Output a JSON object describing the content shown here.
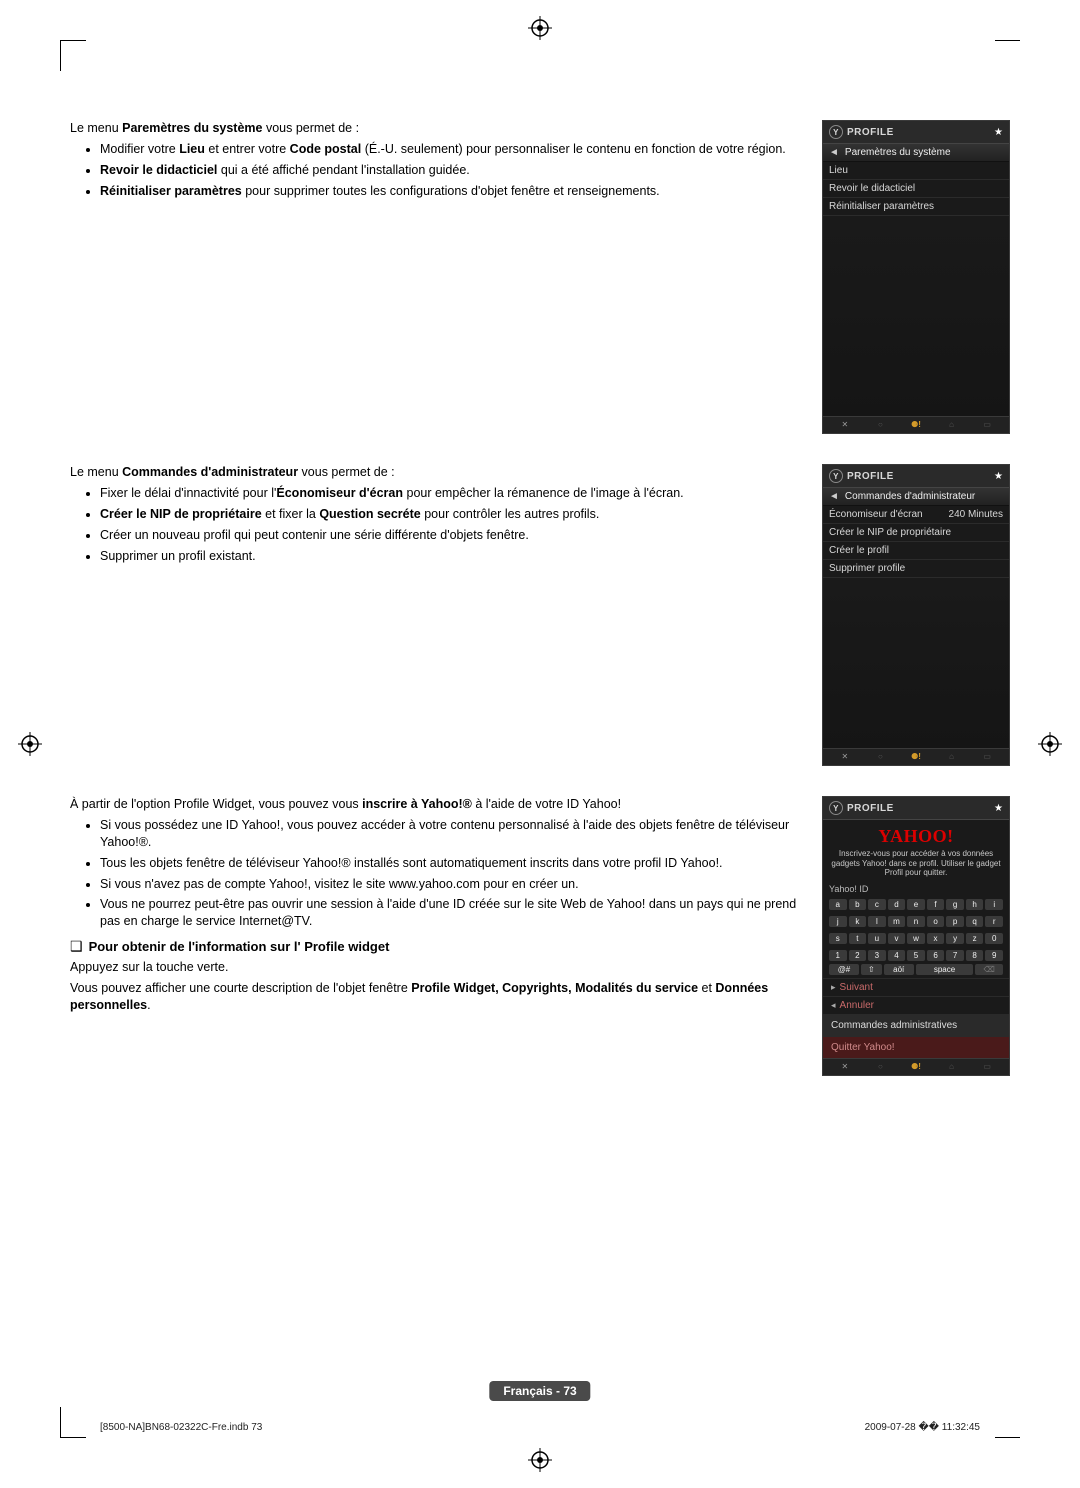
{
  "sec1": {
    "intro_pre": "Le menu ",
    "intro_bold": "Paremètres du système",
    "intro_post": " vous permet de :",
    "b1_pre": "Modifier votre ",
    "b1_b1": "Lieu",
    "b1_mid": " et entrer votre ",
    "b1_b2": "Code postal",
    "b1_post": " (É.-U. seulement) pour personnaliser le contenu en fonction de votre région.",
    "b2_b": "Revoir le didacticiel",
    "b2_post": " qui a été affiché pendant l'installation guidée.",
    "b3_b": "Réinitialiser paramètres",
    "b3_post": " pour supprimer toutes les configurations d'objet fenêtre et renseignements."
  },
  "widget1": {
    "title": "PROFILE",
    "sub": "Paremètres du système",
    "r1": "Lieu",
    "r2": "Revoir le didacticiel",
    "r3": "Réinitialiser paramètres"
  },
  "sec2": {
    "intro_pre": "Le menu ",
    "intro_bold": "Commandes d'administrateur",
    "intro_post": " vous permet de :",
    "b1_pre": "Fixer le délai d'innactivité pour l'",
    "b1_b": "Économiseur d'écran",
    "b1_post": " pour empêcher la rémanence de l'image à l'écran.",
    "b2_b1": "Créer le NIP de propriétaire",
    "b2_mid": " et fixer la ",
    "b2_b2": "Question secréte",
    "b2_post": " pour contrôler les autres profils.",
    "b3": "Créer un nouveau profil qui peut contenir une série différente d'objets fenêtre.",
    "b4": "Supprimer un profil existant."
  },
  "widget2": {
    "title": "PROFILE",
    "sub": "Commandes d'administrateur",
    "r1a": "Économiseur d'écran",
    "r1b": "240 Minutes",
    "r2": "Créer le NIP de propriétaire",
    "r3": "Créer le profil",
    "r4": "Supprimer profile"
  },
  "sec3": {
    "p1_pre": "À partir de l'option Profile Widget, vous pouvez vous ",
    "p1_b": "inscrire à Yahoo!®",
    "p1_post": " à l'aide de votre ID Yahoo!",
    "b1": "Si vous possédez une ID Yahoo!, vous pouvez accéder à votre contenu personnalisé à l'aide des objets fenêtre de téléviseur Yahoo!®.",
    "b2": "Tous les objets fenêtre de téléviseur Yahoo!® installés sont automatiquement inscrits dans votre profil ID Yahoo!.",
    "b3": "Si vous n'avez pas de compte Yahoo!, visitez le site www.yahoo.com pour en créer un.",
    "b4": "Vous ne pourrez peut-être pas ouvrir une session à l'aide d'une ID créée sur le site Web de Yahoo! dans un pays qui ne prend pas en charge le service Internet@TV."
  },
  "heading": "Pour obtenir de l'information sur l' Profile widget",
  "sec4": {
    "p1": "Appuyez sur la touche verte.",
    "p2_pre": "Vous pouvez afficher une courte description de l'objet fenêtre ",
    "p2_b": "Profile Widget, Copyrights, Modalités du service",
    "p2_mid": " et ",
    "p2_b2": "Données personnelles",
    "p2_post": "."
  },
  "widget3": {
    "title": "PROFILE",
    "logo": "YAHOO!",
    "instr": "Inscrivez-vous pour accéder à vos données gadgets Yahoo! dans ce profil. Utiliser le gadget Profil pour quitter.",
    "idlabel": "Yahoo! ID",
    "keys_r1": [
      "a",
      "b",
      "c",
      "d",
      "e",
      "f",
      "g",
      "h",
      "i"
    ],
    "keys_r2": [
      "j",
      "k",
      "l",
      "m",
      "n",
      "o",
      "p",
      "q",
      "r"
    ],
    "keys_r3": [
      "s",
      "t",
      "u",
      "v",
      "w",
      "x",
      "y",
      "z",
      "0"
    ],
    "keys_r4": [
      "1",
      "2",
      "3",
      "4",
      "5",
      "6",
      "7",
      "8",
      "9"
    ],
    "keys_bottom": [
      "@#",
      "⇧",
      "aöí",
      "space",
      "⌫"
    ],
    "suivant": "Suivant",
    "annuler": "Annuler",
    "cmd": "Commandes administratives",
    "quit": "Quitter Yahoo!"
  },
  "footer": {
    "badge": "Français - 73",
    "left": "[8500-NA]BN68-02322C-Fre.indb   73",
    "right": "2009-07-28   �� 11:32:45"
  }
}
